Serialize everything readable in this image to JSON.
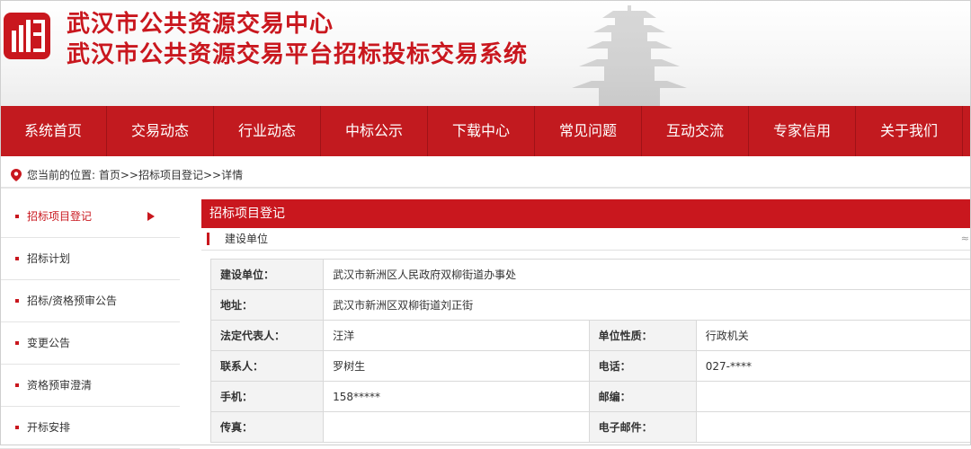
{
  "header": {
    "title_line1": "武汉市公共资源交易中心",
    "title_line2": "武汉市公共资源交易平台招标投标交易系统",
    "brand_color": "#c9171e"
  },
  "nav": {
    "items": [
      "系统首页",
      "交易动态",
      "行业动态",
      "中标公示",
      "下载中心",
      "常见问题",
      "互动交流",
      "专家信用",
      "关于我们"
    ]
  },
  "breadcrumb": {
    "text": "您当前的位置: 首页>>招标项目登记>>详情"
  },
  "sidebar": {
    "items": [
      {
        "label": "招标项目登记",
        "active": true
      },
      {
        "label": "招标计划",
        "active": false
      },
      {
        "label": "招标/资格预审公告",
        "active": false
      },
      {
        "label": "变更公告",
        "active": false
      },
      {
        "label": "资格预审澄清",
        "active": false
      },
      {
        "label": "开标安排",
        "active": false
      }
    ]
  },
  "panel": {
    "title": "招标项目登记",
    "section_title": "建设单位",
    "more": "≈"
  },
  "table": {
    "rows": [
      {
        "label": "建设单位：",
        "value": "武汉市新洲区人民政府双柳街道办事处"
      },
      {
        "label": "地址：",
        "value": "武汉市新洲区双柳街道刘正街"
      },
      {
        "label": "法定代表人：",
        "value": "汪洋",
        "label2": "单位性质：",
        "value2": "行政机关"
      },
      {
        "label": "联系人：",
        "value": "罗树生",
        "label2": "电话：",
        "value2": "027-****"
      },
      {
        "label": "手机：",
        "value": "158*****",
        "label2": "邮编：",
        "value2": ""
      },
      {
        "label": "传真：",
        "value": "",
        "label2": "电子邮件：",
        "value2": ""
      }
    ]
  }
}
